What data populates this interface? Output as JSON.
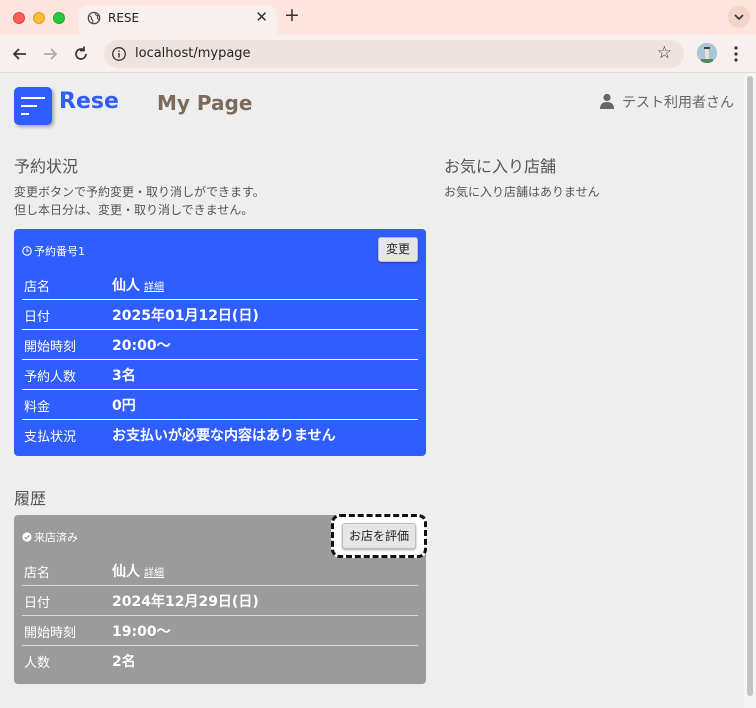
{
  "browser": {
    "tab_title": "RESE",
    "url": "localhost/mypage"
  },
  "header": {
    "logo": "Rese",
    "title": "My Page",
    "user": "テスト利用者さん"
  },
  "reservations": {
    "heading": "予約状況",
    "note_line1": "変更ボタンで予約変更・取り消しができます。",
    "note_line2": "但し本日分は、変更・取り消しできません。",
    "card": {
      "label": "予約番号1",
      "change_label": "変更",
      "detail_link": "詳細",
      "rows": [
        {
          "key": "店名",
          "value": "仙人"
        },
        {
          "key": "日付",
          "value": "2025年01月12日(日)"
        },
        {
          "key": "開始時刻",
          "value": "20:00〜"
        },
        {
          "key": "予約人数",
          "value": "3名"
        },
        {
          "key": "料金",
          "value": "0円"
        },
        {
          "key": "支払状況",
          "value": "お支払いが必要な内容はありません"
        }
      ]
    }
  },
  "favorites": {
    "heading": "お気に入り店舗",
    "empty": "お気に入り店舗はありません"
  },
  "history": {
    "heading": "履歴",
    "card": {
      "label": "来店済み",
      "review_label": "お店を評価",
      "detail_link": "詳細",
      "rows": [
        {
          "key": "店名",
          "value": "仙人"
        },
        {
          "key": "日付",
          "value": "2024年12月29日(日)"
        },
        {
          "key": "開始時刻",
          "value": "19:00〜"
        },
        {
          "key": "人数",
          "value": "2名"
        }
      ]
    }
  },
  "colors": {
    "brand": "#305dff",
    "history_card": "#9b9b9b",
    "title_text": "#7a6b5a"
  }
}
